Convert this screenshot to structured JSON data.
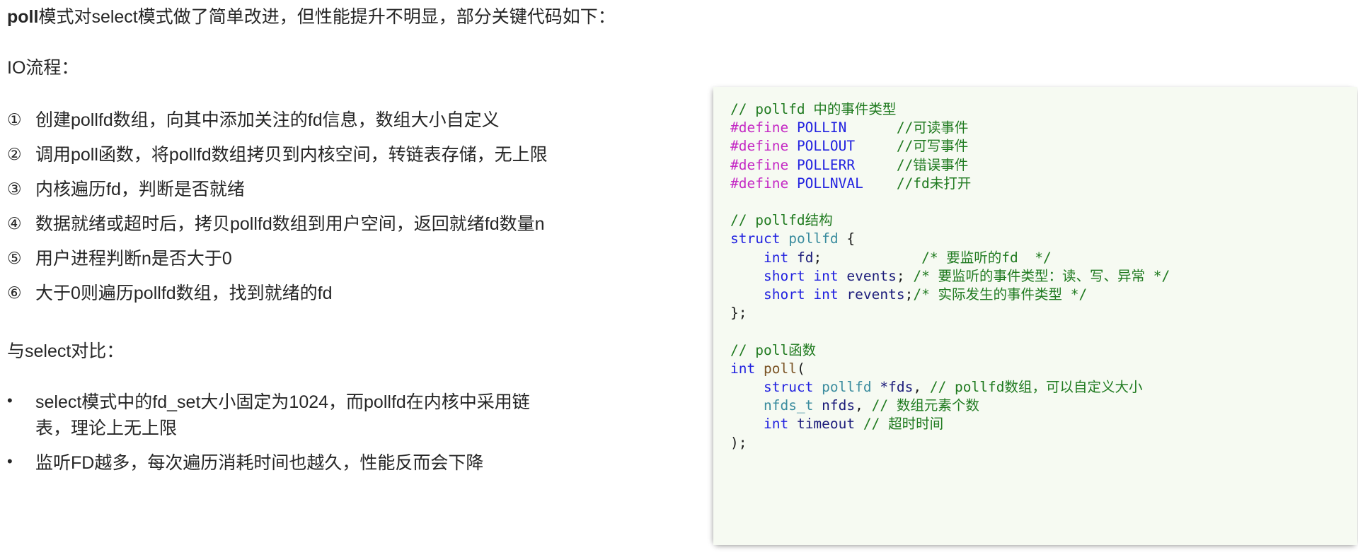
{
  "slide": {
    "intro": {
      "bold_prefix": "poll",
      "rest": "模式对select模式做了简单改进，但性能提升不明显，部分关键代码如下："
    },
    "io_flow_heading": "IO流程：",
    "steps": [
      {
        "marker": "①",
        "text": "创建pollfd数组，向其中添加关注的fd信息，数组大小自定义"
      },
      {
        "marker": "②",
        "text": "调用poll函数，将pollfd数组拷贝到内核空间，转链表存储，无上限"
      },
      {
        "marker": "③",
        "text": "内核遍历fd，判断是否就绪"
      },
      {
        "marker": "④",
        "text": "数据就绪或超时后，拷贝pollfd数组到用户空间，返回就绪fd数量n"
      },
      {
        "marker": "⑤",
        "text": "用户进程判断n是否大于0"
      },
      {
        "marker": "⑥",
        "text": "大于0则遍历pollfd数组，找到就绪的fd"
      }
    ],
    "compare_heading": "与select对比：",
    "bullets": [
      {
        "marker": "•",
        "text": "select模式中的fd_set大小固定为1024，而pollfd在内核中采用链表，理论上无上限"
      },
      {
        "marker": "•",
        "text": "监听FD越多，每次遍历消耗时间也越久，性能反而会下降"
      }
    ]
  },
  "code": {
    "language": "c",
    "background_color": "#f6faf2",
    "colors": {
      "comment": "#1f7a1f",
      "macro": "#c428c4",
      "keyword": "#2222e0",
      "type": "#3a8c9e",
      "identifier": "#1b1b7a",
      "function": "#7a5223",
      "punctuation": "#1a1a1a"
    },
    "lines": [
      [
        {
          "t": "// pollfd 中的事件类型",
          "c": "comment"
        }
      ],
      [
        {
          "t": "#define",
          "c": "macro"
        },
        {
          "t": " ",
          "c": "punct"
        },
        {
          "t": "POLLIN",
          "c": "const"
        },
        {
          "t": "      ",
          "c": "punct"
        },
        {
          "t": "//可读事件",
          "c": "comment"
        }
      ],
      [
        {
          "t": "#define",
          "c": "macro"
        },
        {
          "t": " ",
          "c": "punct"
        },
        {
          "t": "POLLOUT",
          "c": "const"
        },
        {
          "t": "     ",
          "c": "punct"
        },
        {
          "t": "//可写事件",
          "c": "comment"
        }
      ],
      [
        {
          "t": "#define",
          "c": "macro"
        },
        {
          "t": " ",
          "c": "punct"
        },
        {
          "t": "POLLERR",
          "c": "const"
        },
        {
          "t": "     ",
          "c": "punct"
        },
        {
          "t": "//错误事件",
          "c": "comment"
        }
      ],
      [
        {
          "t": "#define",
          "c": "macro"
        },
        {
          "t": " ",
          "c": "punct"
        },
        {
          "t": "POLLNVAL",
          "c": "const"
        },
        {
          "t": "    ",
          "c": "punct"
        },
        {
          "t": "//fd未打开",
          "c": "comment"
        }
      ],
      [],
      [
        {
          "t": "// pollfd结构",
          "c": "comment"
        }
      ],
      [
        {
          "t": "struct",
          "c": "kw"
        },
        {
          "t": " ",
          "c": "punct"
        },
        {
          "t": "pollfd",
          "c": "type"
        },
        {
          "t": " {",
          "c": "punct"
        }
      ],
      [
        {
          "t": "    ",
          "c": "punct"
        },
        {
          "t": "int",
          "c": "kw"
        },
        {
          "t": " ",
          "c": "punct"
        },
        {
          "t": "fd",
          "c": "ident"
        },
        {
          "t": ";",
          "c": "punct"
        },
        {
          "t": "            ",
          "c": "punct"
        },
        {
          "t": "/* 要监听的fd  */",
          "c": "comment"
        }
      ],
      [
        {
          "t": "    ",
          "c": "punct"
        },
        {
          "t": "short int",
          "c": "kw"
        },
        {
          "t": " ",
          "c": "punct"
        },
        {
          "t": "events",
          "c": "ident"
        },
        {
          "t": "; ",
          "c": "punct"
        },
        {
          "t": "/* 要监听的事件类型：读、写、异常 */",
          "c": "comment"
        }
      ],
      [
        {
          "t": "    ",
          "c": "punct"
        },
        {
          "t": "short int",
          "c": "kw"
        },
        {
          "t": " ",
          "c": "punct"
        },
        {
          "t": "revents",
          "c": "ident"
        },
        {
          "t": ";",
          "c": "punct"
        },
        {
          "t": "/* 实际发生的事件类型 */",
          "c": "comment"
        }
      ],
      [
        {
          "t": "};",
          "c": "punct"
        }
      ],
      [],
      [
        {
          "t": "// poll函数",
          "c": "comment"
        }
      ],
      [
        {
          "t": "int",
          "c": "kw"
        },
        {
          "t": " ",
          "c": "punct"
        },
        {
          "t": "poll",
          "c": "fn"
        },
        {
          "t": "(",
          "c": "punct"
        }
      ],
      [
        {
          "t": "    ",
          "c": "punct"
        },
        {
          "t": "struct",
          "c": "kw"
        },
        {
          "t": " ",
          "c": "punct"
        },
        {
          "t": "pollfd",
          "c": "type"
        },
        {
          "t": " ",
          "c": "punct"
        },
        {
          "t": "*fds",
          "c": "ident"
        },
        {
          "t": ", ",
          "c": "punct"
        },
        {
          "t": "// pollfd数组，可以自定义大小",
          "c": "comment"
        }
      ],
      [
        {
          "t": "    ",
          "c": "punct"
        },
        {
          "t": "nfds_t",
          "c": "type"
        },
        {
          "t": " ",
          "c": "punct"
        },
        {
          "t": "nfds",
          "c": "ident"
        },
        {
          "t": ", ",
          "c": "punct"
        },
        {
          "t": "// 数组元素个数",
          "c": "comment"
        }
      ],
      [
        {
          "t": "    ",
          "c": "punct"
        },
        {
          "t": "int",
          "c": "kw"
        },
        {
          "t": " ",
          "c": "punct"
        },
        {
          "t": "timeout",
          "c": "ident"
        },
        {
          "t": " ",
          "c": "punct"
        },
        {
          "t": "// 超时时间",
          "c": "comment"
        }
      ],
      [
        {
          "t": ");",
          "c": "punct"
        }
      ]
    ]
  }
}
